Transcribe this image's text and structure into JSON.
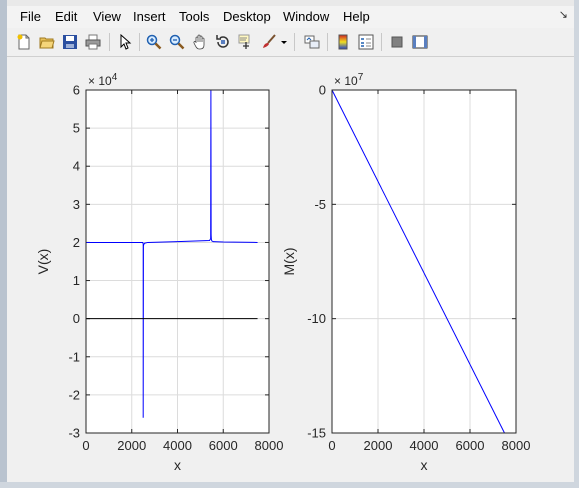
{
  "menu": {
    "items": [
      "File",
      "Edit",
      "View",
      "Insert",
      "Tools",
      "Desktop",
      "Window",
      "Help"
    ],
    "dock_arrow": "↘"
  },
  "toolbar": {
    "icons": [
      "new-figure-icon",
      "open-file-icon",
      "save-icon",
      "print-icon",
      "pointer-icon",
      "zoom-in-icon",
      "zoom-out-icon",
      "pan-hand-icon",
      "rotate-3d-icon",
      "data-cursor-icon",
      "brush-icon",
      "brush-dropdown-icon",
      "link-plot-icon",
      "colorbar-icon",
      "legend-icon",
      "hide-plot-tools-icon",
      "show-plot-tools-icon"
    ]
  },
  "colors": {
    "line": "#0000ff",
    "zero_line": "#000000",
    "grid": "#dcdcdc",
    "axes_bg": "#ffffff",
    "figure_bg": "#f0f0f0"
  },
  "chart_data": [
    {
      "type": "line",
      "xlabel": "x",
      "ylabel": "V(x)",
      "exponent_label": "× 10",
      "exponent_power": "4",
      "xlim": [
        0,
        8000
      ],
      "ylim": [
        -3,
        6
      ],
      "xticks": [
        "0",
        "2000",
        "4000",
        "6000",
        "8000"
      ],
      "yticks": [
        "-3",
        "-2",
        "-1",
        "0",
        "1",
        "2",
        "3",
        "4",
        "5",
        "6"
      ],
      "grid": true,
      "series": [
        {
          "color": "#0000ff",
          "x": [
            0,
            2480,
            2500,
            2500,
            2510,
            2520,
            2560,
            2700,
            4000,
            5400,
            5450,
            5460,
            5470,
            5480,
            5500,
            5560,
            6000,
            7500
          ],
          "y": [
            2.0,
            2.0,
            1.96,
            -2.6,
            1.9,
            1.94,
            1.98,
            2.0,
            2.02,
            2.05,
            2.1,
            6.0,
            2.2,
            2.08,
            2.04,
            2.02,
            2.01,
            2.0
          ]
        },
        {
          "color": "#000000",
          "x": [
            0,
            7500
          ],
          "y": [
            0,
            0
          ]
        }
      ]
    },
    {
      "type": "line",
      "xlabel": "x",
      "ylabel": "M(x)",
      "exponent_label": "× 10",
      "exponent_power": "7",
      "xlim": [
        0,
        8000
      ],
      "ylim": [
        -15,
        0
      ],
      "xticks": [
        "0",
        "2000",
        "4000",
        "6000",
        "8000"
      ],
      "yticks": [
        "-15",
        "-10",
        "-5",
        "0"
      ],
      "grid": true,
      "series": [
        {
          "color": "#0000ff",
          "x": [
            0,
            7500
          ],
          "y": [
            0,
            -15
          ]
        },
        {
          "color": "#000000",
          "x": [
            0,
            7500
          ],
          "y": [
            0,
            0
          ]
        }
      ]
    }
  ]
}
